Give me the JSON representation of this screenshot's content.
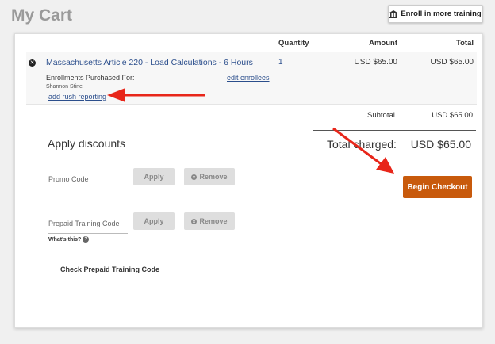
{
  "page": {
    "title": "My Cart"
  },
  "header": {
    "enroll_button_label": "Enroll in more training",
    "enroll_icon": "building-icon"
  },
  "table": {
    "columns": {
      "quantity": "Quantity",
      "amount": "Amount",
      "total": "Total"
    },
    "items": [
      {
        "course": "Massachusetts Article 220 - Load Calculations - 6 Hours",
        "quantity": "1",
        "amount": "USD $65.00",
        "total": "USD $65.00",
        "enrollments_label": "Enrollments Purchased For:",
        "enrollee": "Shannon Stine",
        "edit_enrollees_label": "edit enrollees",
        "rush_reporting_label": "add rush reporting"
      }
    ]
  },
  "summary": {
    "subtotal_label": "Subtotal",
    "subtotal_value": "USD $65.00",
    "total_charged_label": "Total charged:",
    "total_charged_value": "USD $65.00"
  },
  "discounts": {
    "heading": "Apply discounts",
    "promo_placeholder": "Promo Code",
    "prepaid_placeholder": "Prepaid Training Code",
    "apply_label": "Apply",
    "remove_label": "Remove",
    "whats_this_label": "What's this?",
    "check_prepaid_label": "Check Prepaid Training Code"
  },
  "checkout": {
    "button_label": "Begin Checkout",
    "color": "#c85a0c"
  },
  "annotations": {
    "arrow_color": "#e8261a"
  }
}
